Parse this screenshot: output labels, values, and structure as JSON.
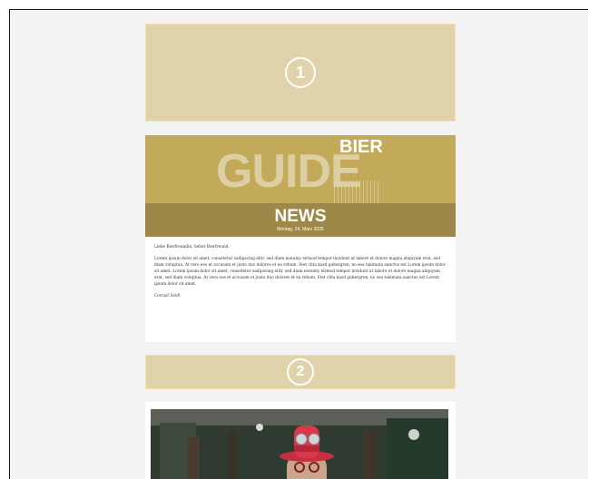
{
  "placeholders": [
    {
      "number": "1"
    },
    {
      "number": "2"
    }
  ],
  "newsletter": {
    "brand_small": "BIER",
    "brand_large": "GUIDE",
    "section_title": "NEWS",
    "date": "Montag, 24. März 2025",
    "greeting": "Liebe Bierfreundin, lieber Bierfreund,",
    "body": "Lorem ipsum dolor sit amet, consetetur sadipscing elitr, sed diam nonumy eirmod tempor invidunt ut labore et dolore magna aliquyam erat, sed diam voluptua. At vero eos et accusam et justo duo dolores et ea rebum. Stet clita kasd gubergren, no sea takimata sanctus est Lorem ipsum dolor sit amet. Lorem ipsum dolor sit amet, consetetur sadipscing elitr, sed diam nonumy eirmod tempor invidunt ut labore et dolore magna aliquyam erat, sed diam voluptua. At vero eos et accusam et justo duo dolores et ea rebum. Stet clita kasd gubergren, no sea takimata sanctus est Lorem ipsum dolor sit amet.",
    "signature": "Conrad Seidl"
  },
  "colors": {
    "placeholder_fill": "#e0d2ab",
    "banner_gold": "#c3a95a",
    "banner_dark": "#9d8849",
    "hat_red": "#d8384a"
  }
}
